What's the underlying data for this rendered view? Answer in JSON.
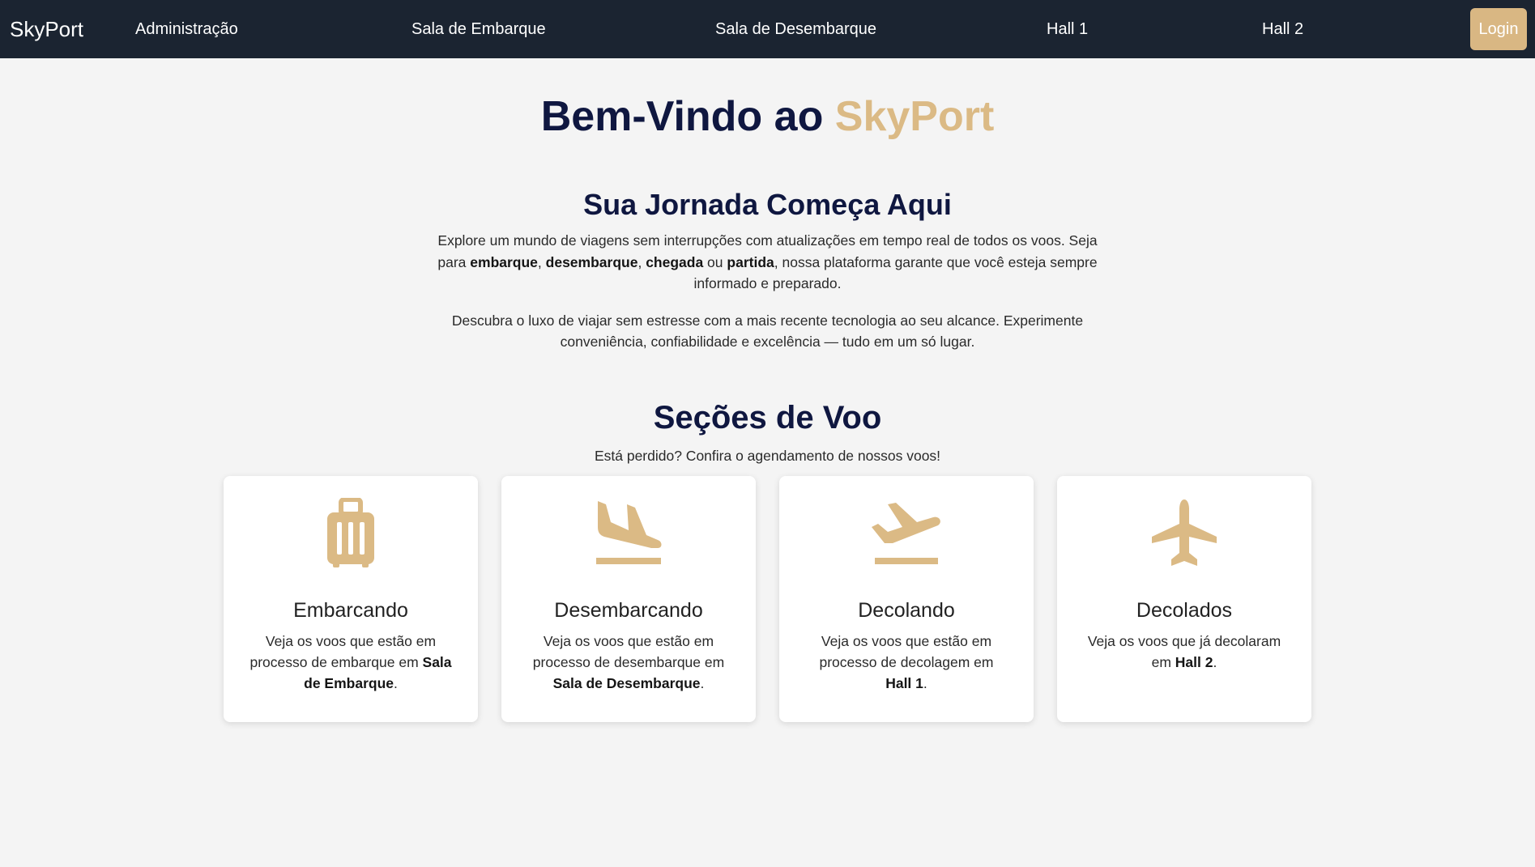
{
  "navbar": {
    "brand": "SkyPort",
    "links": [
      "Administração",
      "Sala de Embarque",
      "Sala de Desembarque",
      "Hall 1",
      "Hall 2"
    ],
    "login_label": "Login"
  },
  "hero": {
    "title_prefix": "Bem-Vindo ao ",
    "title_accent": "SkyPort"
  },
  "intro": {
    "heading": "Sua Jornada Começa Aqui",
    "p1_a": "Explore um mundo de viagens sem interrupções com atualizações em tempo real de todos os voos. Seja para ",
    "p1_b1": "embarque",
    "p1_sep1": ", ",
    "p1_b2": "desembarque",
    "p1_sep2": ", ",
    "p1_b3": "chegada",
    "p1_sep3": " ou ",
    "p1_b4": "partida",
    "p1_c": ", nossa plataforma garante que você esteja sempre informado e preparado.",
    "p2": "Descubra o luxo de viajar sem estresse com a mais recente tecnologia ao seu alcance. Experimente conveniência, confiabilidade e excelência — tudo em um só lugar."
  },
  "sections": {
    "title": "Seções de Voo",
    "subtitle": "Está perdido? Confira o agendamento de nossos voos!",
    "cards": [
      {
        "icon": "suitcase-icon",
        "title": "Embarcando",
        "desc": "Veja os voos que estão em processo de embarque em ",
        "bold": "Sala de Embarque",
        "end": "."
      },
      {
        "icon": "plane-arrival-icon",
        "title": "Desembarcando",
        "desc": "Veja os voos que estão em processo de desembarque em ",
        "bold": "Sala de Desembarque",
        "end": "."
      },
      {
        "icon": "plane-departure-icon",
        "title": "Decolando",
        "desc": "Veja os voos que estão em processo de decolagem em ",
        "bold": "Hall 1",
        "end": "."
      },
      {
        "icon": "plane-icon",
        "title": "Decolados",
        "desc": "Veja os voos que já decolaram em ",
        "bold": "Hall 2",
        "end": "."
      }
    ]
  },
  "colors": {
    "navbar_bg": "#1b2431",
    "accent": "#dbba85",
    "heading": "#0f1740",
    "background": "#f4f4f4"
  }
}
